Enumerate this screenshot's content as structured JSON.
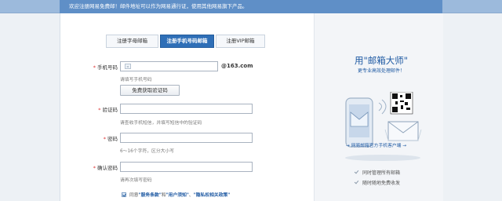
{
  "topbar": {
    "notice": "欢迎注册网易免费邮！邮件地址可以作为网易通行证，使用其他网易旗下产品。"
  },
  "tabs": [
    {
      "label": "注册字母邮箱",
      "active": false
    },
    {
      "label": "注册手机号码邮箱",
      "active": true
    },
    {
      "label": "注册VIP邮箱",
      "active": false
    }
  ],
  "form": {
    "phone": {
      "label": "手机号码",
      "value": "",
      "domain": "@163.com",
      "hint": "请填写手机号码"
    },
    "get_code_button": "免费获取验证码",
    "code": {
      "label": "验证码",
      "value": "",
      "hint": "请查收手机短信，并填写短信中的验证码"
    },
    "password": {
      "label": "密码",
      "value": "",
      "hint": "6～16个字符，区分大小写"
    },
    "confirm_password": {
      "label": "确认密码",
      "value": "",
      "hint": "请再次填写密码"
    },
    "agree": {
      "prefix": "同意",
      "terms": "\"服务条款\"",
      "and": "和",
      "notice": "\"用户须知\"",
      "sep": "、",
      "privacy": "\"隐私权相关政策\""
    }
  },
  "promo": {
    "title": "用\"邮箱大师\"",
    "subtitle": "更专业高效处理邮件！",
    "link": "→ 网易邮箱官方手机客户端 →",
    "features": [
      "同时管理所有邮箱",
      "随时随地免费收发"
    ]
  },
  "colors": {
    "accent": "#2f6fb7",
    "topbar": "#5f8fc7"
  }
}
